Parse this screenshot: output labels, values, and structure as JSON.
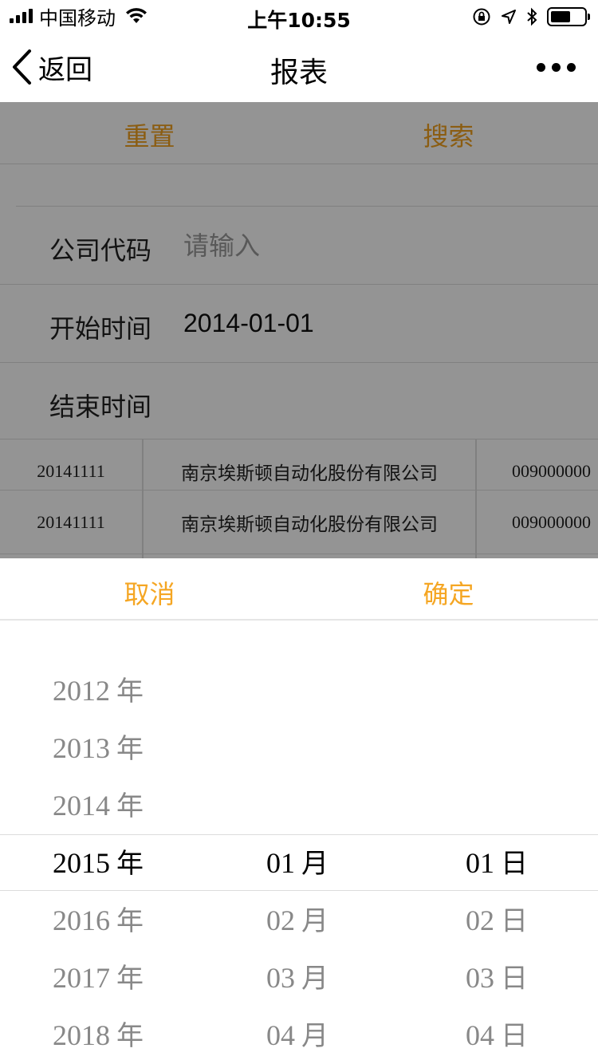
{
  "status_bar": {
    "carrier": "中国移动",
    "time": "上午10:55"
  },
  "nav": {
    "back_label": "返回",
    "title": "报表"
  },
  "actions": {
    "reset_label": "重置",
    "search_label": "搜索"
  },
  "form": {
    "company_code": {
      "label": "公司代码",
      "placeholder": "请输入",
      "value": ""
    },
    "start_time": {
      "label": "开始时间",
      "value": "2014-01-01"
    },
    "end_time": {
      "label": "结束时间",
      "value": ""
    }
  },
  "table": {
    "rows": [
      {
        "date": "20141111",
        "company": "南京埃斯顿自动化股份有限公司",
        "code": "009000000"
      },
      {
        "date": "20141111",
        "company": "南京埃斯顿自动化股份有限公司",
        "code": "009000000"
      }
    ]
  },
  "picker": {
    "cancel_label": "取消",
    "confirm_label": "确定",
    "year_unit": "年",
    "month_unit": "月",
    "day_unit": "日",
    "years": [
      "2012",
      "2013",
      "2014",
      "2015",
      "2016",
      "2017",
      "2018"
    ],
    "months": [
      "01",
      "02",
      "03",
      "04"
    ],
    "days": [
      "01",
      "02",
      "03",
      "04"
    ],
    "selected": {
      "year": "2015",
      "month": "01",
      "day": "01"
    }
  },
  "colors": {
    "accent": "#f5a623",
    "accent_dimmed": "#f0a020",
    "overlay": "rgba(0,0,0,0.42)",
    "selected_text": "#000000",
    "unselected_text": "#888888"
  }
}
